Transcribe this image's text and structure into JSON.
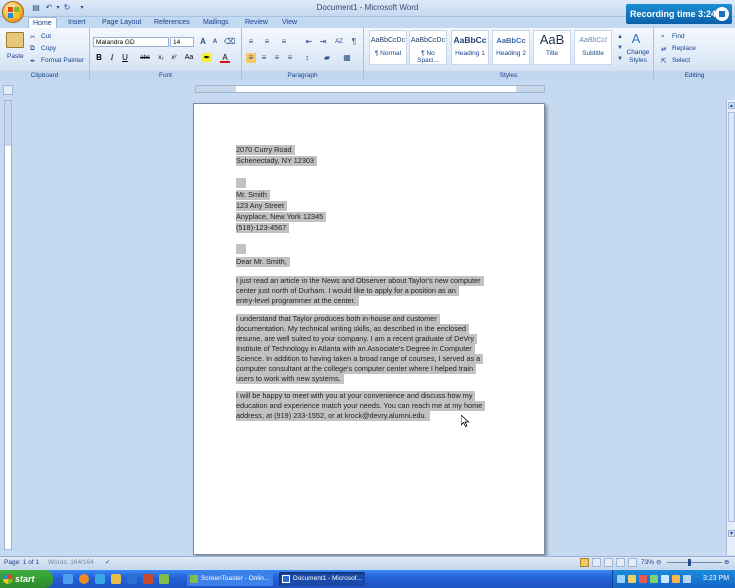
{
  "window": {
    "title": "Document1 - Microsoft Word"
  },
  "recording": {
    "label": "Recording time 3:24"
  },
  "tabs": [
    "Home",
    "Insert",
    "Page Layout",
    "References",
    "Mailings",
    "Review",
    "View"
  ],
  "clipboard": {
    "paste": "Paste",
    "cut": "Cut",
    "copy": "Copy",
    "format_painter": "Format Painter",
    "label": "Clipboard"
  },
  "font": {
    "name": "Malandra GD",
    "size": "14",
    "label": "Font"
  },
  "paragraph": {
    "label": "Paragraph"
  },
  "styles": {
    "items": [
      {
        "preview": "AaBbCcDc",
        "name": "¶ Normal"
      },
      {
        "preview": "AaBbCcDc",
        "name": "¶ No Spaci..."
      },
      {
        "preview": "AaBbCc",
        "name": "Heading 1"
      },
      {
        "preview": "AaBbCc",
        "name": "Heading 2"
      },
      {
        "preview": "AaB",
        "name": "Title"
      },
      {
        "preview": "AaBbCcI",
        "name": "Subtitle"
      }
    ],
    "change": "Change Styles",
    "label": "Styles"
  },
  "editing": {
    "find": "Find",
    "replace": "Replace",
    "select": "Select",
    "label": "Editing"
  },
  "document": {
    "lines": [
      "2070 Curry Road",
      "Schenectady, NY 12303",
      "",
      "Mr. Smith",
      "123 Any Street",
      "Anyplace, New York 12345",
      "(518)-123-4567",
      "",
      "Dear Mr. Smith,",
      "I just read an article in the News and Observer about Taylor's new computer",
      "center just north of Durham. I would like to apply for a position as an",
      "entry-level programmer at the center.",
      "I understand that Taylor produces both in-house and customer",
      "documentation. My technical writing skills, as described in the enclosed",
      "resume, are well suited to your company. I am a recent graduate of DeVry",
      "Institute of Technology in Atlanta with an Associate's Degree in Computer",
      "Science. In addition to having taken a broad range of courses, I served as a",
      "computer consultant at the college's computer center where I helped train",
      "users to work with new systems.",
      "I will be happy to meet with you at your convenience and discuss how my",
      "education and experience match your needs. You can reach me at my home",
      "address, at (919) 233-1552, or at krock@devry.alumni.edu."
    ]
  },
  "status": {
    "page": "Page: 1 of 1",
    "words": "Words: 164/164",
    "zoom": "73%"
  },
  "taskbar": {
    "start": "start",
    "tasks": [
      "ScreenToaster - Onlin...",
      "Document1 - Microsof..."
    ],
    "time": "3:23 PM"
  }
}
